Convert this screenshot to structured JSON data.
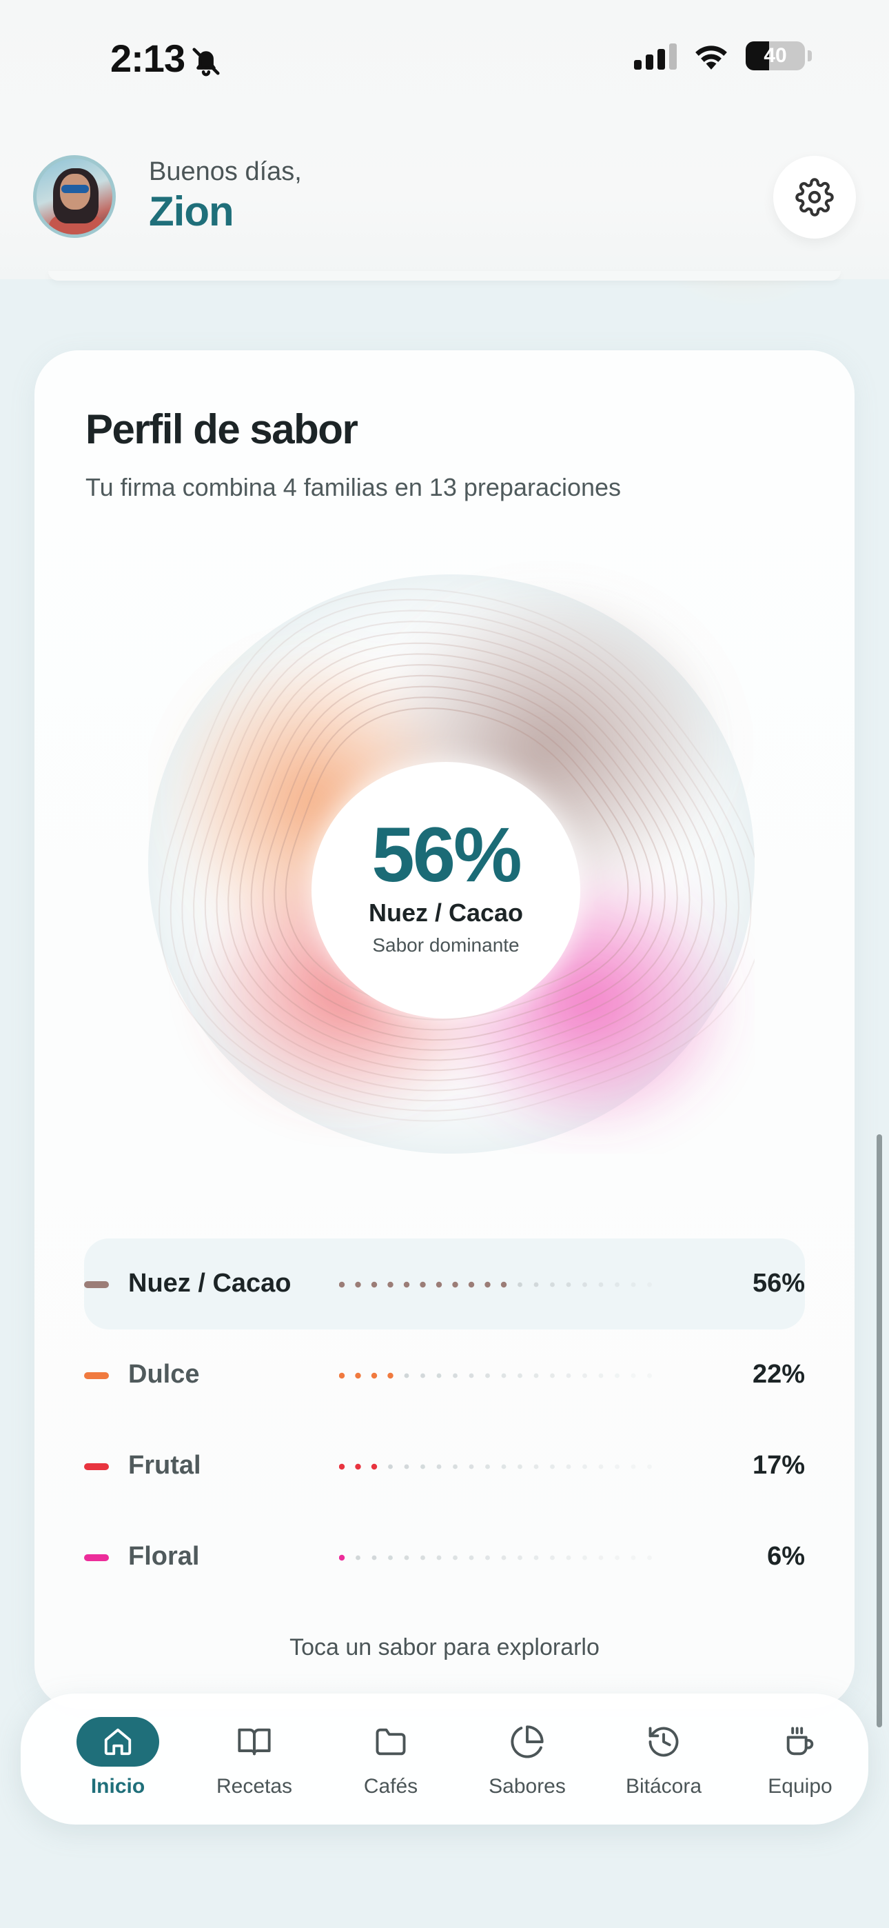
{
  "status_bar": {
    "time": "2:13",
    "battery": "40"
  },
  "header": {
    "greeting": "Buenos días,",
    "user_name": "Zion"
  },
  "card": {
    "title": "Perfil de sabor",
    "subtitle": "Tu firma combina 4 familias en 13 preparaciones",
    "center": {
      "percent": "56%",
      "label": "Nuez / Cacao",
      "sub": "Sabor dominante"
    },
    "flavors": [
      {
        "label": "Nuez / Cacao",
        "percent": "56%",
        "value": 0.56,
        "color": "#9b7d77",
        "active": true
      },
      {
        "label": "Dulce",
        "percent": "22%",
        "value": 0.22,
        "color": "#f07a3f",
        "active": false
      },
      {
        "label": "Frutal",
        "percent": "17%",
        "value": 0.17,
        "color": "#e8343f",
        "active": false
      },
      {
        "label": "Floral",
        "percent": "6%",
        "value": 0.06,
        "color": "#ec2d9a",
        "active": false
      }
    ],
    "hint": "Toca un sabor para explorarlo"
  },
  "tabs": [
    {
      "label": "Inicio",
      "icon": "home-icon",
      "active": true
    },
    {
      "label": "Recetas",
      "icon": "book-icon",
      "active": false
    },
    {
      "label": "Cafés",
      "icon": "folder-icon",
      "active": false
    },
    {
      "label": "Sabores",
      "icon": "pie-chart-icon",
      "active": false
    },
    {
      "label": "Bitácora",
      "icon": "history-icon",
      "active": false
    },
    {
      "label": "Equipo",
      "icon": "coffee-cup-icon",
      "active": false
    }
  ]
}
